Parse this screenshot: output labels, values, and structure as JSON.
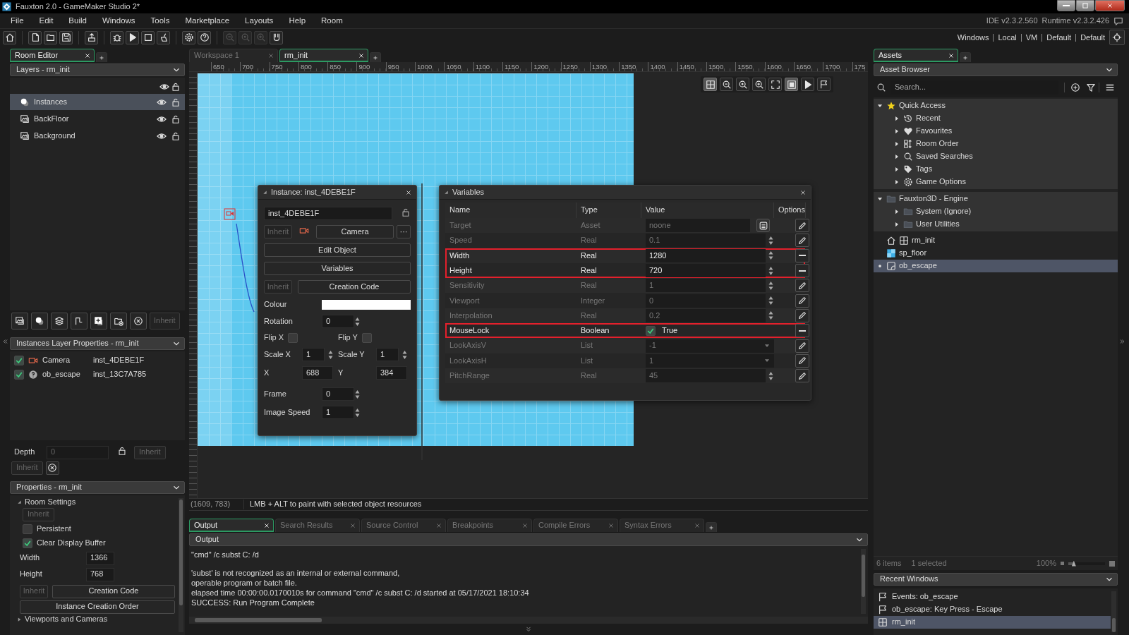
{
  "window": {
    "title": "Fauxton 2.0 - GameMaker Studio 2*"
  },
  "menu": [
    "File",
    "Edit",
    "Build",
    "Windows",
    "Tools",
    "Marketplace",
    "Layouts",
    "Help",
    "Room"
  ],
  "version": {
    "ide": "IDE v2.3.2.560",
    "runtime": "Runtime v2.3.2.426"
  },
  "toolbar": [
    [
      {
        "kind": "home",
        "disabled": false
      }
    ],
    [
      {
        "kind": "new",
        "disabled": false
      },
      {
        "kind": "open",
        "disabled": false
      },
      {
        "kind": "save",
        "disabled": false
      }
    ],
    [
      {
        "kind": "export",
        "disabled": false
      }
    ],
    [
      {
        "kind": "debug",
        "disabled": false
      },
      {
        "kind": "run",
        "disabled": false
      },
      {
        "kind": "stop",
        "disabled": false
      },
      {
        "kind": "clean",
        "disabled": false
      }
    ],
    [
      {
        "kind": "gear",
        "disabled": false
      },
      {
        "kind": "help",
        "disabled": false
      }
    ],
    [
      {
        "kind": "zoom-out",
        "disabled": true
      },
      {
        "kind": "zoom-reset",
        "disabled": true
      },
      {
        "kind": "zoom-in",
        "disabled": true
      },
      {
        "kind": "gamepad",
        "disabled": false
      }
    ]
  ],
  "targets": [
    "Windows",
    "Local",
    "VM",
    "Default",
    "Default"
  ],
  "left_panel": {
    "tabs": [
      {
        "label": "Room Editor",
        "selected": true
      }
    ],
    "layers": {
      "title": "Layers - rm_init",
      "items": [
        {
          "name": "Instances",
          "kind": "instances",
          "selected": true
        },
        {
          "name": "BackFloor",
          "kind": "background",
          "selected": false
        },
        {
          "name": "Background",
          "kind": "background",
          "selected": false
        }
      ],
      "tools": [
        {
          "kind": "background"
        },
        {
          "kind": "instances"
        },
        {
          "kind": "tiles"
        },
        {
          "kind": "path"
        },
        {
          "kind": "assets"
        },
        {
          "kind": "folder-add"
        },
        {
          "kind": "delete"
        }
      ],
      "tools_inherit": "Inherit"
    },
    "layer_properties": {
      "title": "Instances Layer Properties - rm_init",
      "instances": [
        {
          "object": "Camera",
          "kind": "camera",
          "instance": "inst_4DEBE1F",
          "checked": true
        },
        {
          "object": "ob_escape",
          "kind": "unknown",
          "instance": "inst_13C7A785",
          "checked": true
        }
      ],
      "depth_label": "Depth",
      "depth": "0",
      "depth_inherit": "Inherit",
      "inherit": "Inherit"
    },
    "properties": {
      "title": "Properties - rm_init",
      "section": "Room Settings",
      "inherit": "Inherit",
      "persistent": {
        "label": "Persistent",
        "checked": false
      },
      "clear_display_buffer": {
        "label": "Clear Display Buffer",
        "checked": true
      },
      "width": {
        "label": "Width",
        "value": "1366"
      },
      "height": {
        "label": "Height",
        "value": "768"
      },
      "inherit2": "Inherit",
      "creation_code": "Creation Code",
      "instance_creation_order": "Instance Creation Order",
      "next_section": "Viewports and Cameras"
    }
  },
  "editor": {
    "tabs": [
      {
        "label": "Workspace 1",
        "selected": false
      },
      {
        "label": "rm_init",
        "selected": true
      }
    ],
    "ruler": [
      "650",
      "700",
      "750",
      "800",
      "850",
      "900",
      "950",
      "1000",
      "1050",
      "1100",
      "1150",
      "1200",
      "1250",
      "1300",
      "1350",
      "1400",
      "1450",
      "1500",
      "1550",
      "1600",
      "1650",
      "1700",
      "175"
    ],
    "room_toolbar": [
      {
        "kind": "grid",
        "on": true
      },
      {
        "kind": "zoom-out",
        "on": false
      },
      {
        "kind": "zoom-reset",
        "on": false
      },
      {
        "kind": "zoom-in",
        "on": false
      },
      {
        "kind": "fit",
        "on": false
      },
      {
        "kind": "frame",
        "on": true
      },
      {
        "kind": "run",
        "on": false
      },
      {
        "kind": "flag",
        "on": false
      }
    ],
    "status": {
      "coords": "(1609, 783)",
      "hint": "LMB + ALT to paint with selected object resources"
    }
  },
  "instance_window": {
    "title": "Instance: inst_4DEBE1F",
    "name": "inst_4DEBE1F",
    "inherit": "Inherit",
    "object": "Camera",
    "more": "···",
    "buttons": [
      "Edit Object",
      "Variables"
    ],
    "inherit2": "Inherit",
    "creation_code": "Creation Code",
    "colour_label": "Colour",
    "rotation": {
      "label": "Rotation",
      "value": "0"
    },
    "flip_x": {
      "label": "Flip X",
      "checked": false
    },
    "flip_y": {
      "label": "Flip Y",
      "checked": false
    },
    "scale_x": {
      "label": "Scale X",
      "value": "1"
    },
    "scale_y": {
      "label": "Scale Y",
      "value": "1"
    },
    "x": {
      "label": "X",
      "value": "688"
    },
    "y": {
      "label": "Y",
      "value": "384"
    },
    "frame": {
      "label": "Frame",
      "value": "0"
    },
    "image_speed": {
      "label": "Image Speed",
      "value": "1"
    }
  },
  "variables_window": {
    "title": "Variables",
    "columns": [
      "Name",
      "Type",
      "Value",
      "Options"
    ],
    "rows": [
      {
        "name": "Target",
        "type": "Asset",
        "kind": "asset",
        "value": "noone",
        "overridden": false,
        "highlighted": false
      },
      {
        "name": "Speed",
        "type": "Real",
        "kind": "number",
        "value": "0.1",
        "overridden": false,
        "highlighted": false
      },
      {
        "name": "Width",
        "type": "Real",
        "kind": "number",
        "value": "1280",
        "overridden": true,
        "highlighted": true
      },
      {
        "name": "Height",
        "type": "Real",
        "kind": "number",
        "value": "720",
        "overridden": true,
        "highlighted": true
      },
      {
        "name": "Sensitivity",
        "type": "Real",
        "kind": "number",
        "value": "1",
        "overridden": false,
        "highlighted": false
      },
      {
        "name": "Viewport",
        "type": "Integer",
        "kind": "number",
        "value": "0",
        "overridden": false,
        "highlighted": false
      },
      {
        "name": "Interpolation",
        "type": "Real",
        "kind": "number",
        "value": "0.2",
        "overridden": false,
        "highlighted": false
      },
      {
        "name": "MouseLock",
        "type": "Boolean",
        "kind": "boolean",
        "value": "True",
        "checked": true,
        "overridden": true,
        "highlighted": true
      },
      {
        "name": "LookAxisV",
        "type": "List",
        "kind": "list",
        "value": "-1",
        "overridden": false,
        "highlighted": false
      },
      {
        "name": "LookAxisH",
        "type": "List",
        "kind": "list",
        "value": "1",
        "overridden": false,
        "highlighted": false
      },
      {
        "name": "PitchRange",
        "type": "Real",
        "kind": "number",
        "value": "45",
        "overridden": false,
        "highlighted": false
      }
    ]
  },
  "assets_panel": {
    "tabs": [
      {
        "label": "Assets",
        "selected": true
      }
    ],
    "title": "Asset Browser",
    "search_placeholder": "Search...",
    "tree": [
      {
        "label": "Quick Access",
        "kind": "star",
        "expanded": true,
        "children": [
          {
            "label": "Recent",
            "kind": "history",
            "expanded": false
          },
          {
            "label": "Favourites",
            "kind": "heart",
            "expanded": false
          },
          {
            "label": "Room Order",
            "kind": "room-order",
            "expanded": false
          },
          {
            "label": "Saved Searches",
            "kind": "search",
            "expanded": false
          },
          {
            "label": "Tags",
            "kind": "tag",
            "expanded": false
          },
          {
            "label": "Game Options",
            "kind": "gear",
            "expanded": false
          }
        ]
      },
      {
        "label": "Fauxton3D - Engine",
        "kind": "folder",
        "expanded": true,
        "children": [
          {
            "label": "System (Ignore)",
            "kind": "folder",
            "expanded": false
          },
          {
            "label": "User Utilities",
            "kind": "folder",
            "expanded": false
          }
        ]
      },
      {
        "label": "rm_init",
        "kind": "room",
        "home": true,
        "selected": false
      },
      {
        "label": "sp_floor",
        "kind": "sprite",
        "home": false,
        "selected": false
      },
      {
        "label": "ob_escape",
        "kind": "object",
        "home": false,
        "selected": true
      }
    ],
    "item_count": "6 items",
    "selected_count": "1 selected",
    "zoom": "100%",
    "zoom_slider": {
      "level": 0.15
    },
    "recent_windows": {
      "title": "Recent Windows",
      "items": [
        {
          "label": "Events: ob_escape",
          "kind": "event",
          "selected": false
        },
        {
          "label": "ob_escape: Key Press - Escape",
          "kind": "event",
          "selected": false
        },
        {
          "label": "rm_init",
          "kind": "room",
          "selected": true
        }
      ]
    }
  },
  "output": {
    "tabs": [
      {
        "label": "Output",
        "selected": true
      },
      {
        "label": "Search Results",
        "selected": false
      },
      {
        "label": "Source Control",
        "selected": false
      },
      {
        "label": "Breakpoints",
        "selected": false
      },
      {
        "label": "Compile Errors",
        "selected": false
      },
      {
        "label": "Syntax Errors",
        "selected": false
      }
    ],
    "header": "Output",
    "lines": [
      {
        "text": "\"cmd\"  /c subst C: /d",
        "blank_before": false
      },
      {
        "text": "'subst' is not recognized as an internal or external command,",
        "blank_before": true
      },
      {
        "text": "operable program or batch file.",
        "blank_before": false
      },
      {
        "text": "elapsed time 00:00:00.0170010s for command \"cmd\" /c subst C: /d started at 05/17/2021 18:10:34",
        "blank_before": false
      },
      {
        "text": "SUCCESS: Run Program Complete",
        "blank_before": false
      }
    ]
  }
}
